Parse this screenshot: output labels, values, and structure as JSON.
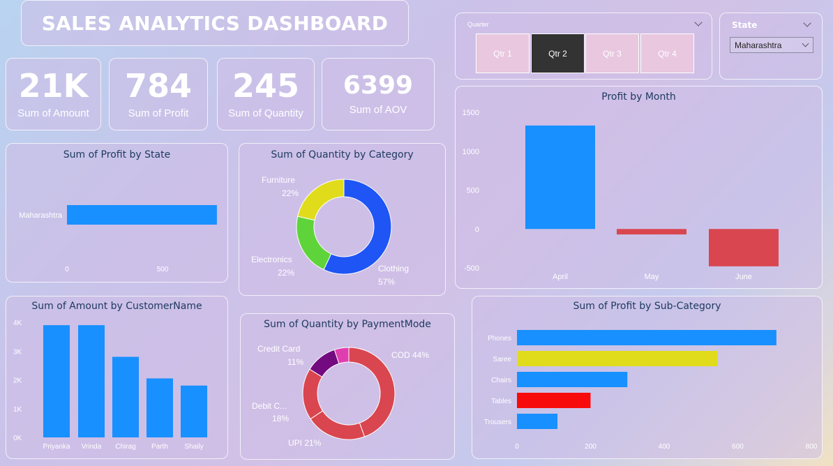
{
  "header": {
    "title": "SALES ANALYTICS DASHBOARD"
  },
  "kpis": [
    {
      "value": "21K",
      "label": "Sum of Amount"
    },
    {
      "value": "784",
      "label": "Sum of Profit"
    },
    {
      "value": "245",
      "label": "Sum of Quantity"
    },
    {
      "value": "6399",
      "label": "Sum of AOV"
    }
  ],
  "quarter_slicer": {
    "label": "Quarter",
    "options": [
      "Qtr 1",
      "Qtr 2",
      "Qtr 3",
      "Qtr 4"
    ],
    "selected": "Qtr 2"
  },
  "state_slicer": {
    "label": "State",
    "selected": "Maharashtra"
  },
  "colors": {
    "blue": "#1890ff",
    "red": "#d9464f",
    "yellow": "#e0dc1c",
    "green": "#5fd43a",
    "royal": "#1f55f5",
    "purple": "#740a80",
    "magenta": "#e03db0",
    "bright_red": "#f80b0b"
  },
  "chart_data": [
    {
      "id": "profit-by-state",
      "type": "bar",
      "orientation": "horizontal",
      "title": "Sum of Profit by State",
      "categories": [
        "Maharashtra"
      ],
      "values": [
        784
      ],
      "xticks": [
        "0",
        "500"
      ],
      "xlim": [
        0,
        850
      ]
    },
    {
      "id": "quantity-by-category",
      "type": "pie",
      "donut": true,
      "title": "Sum of Quantity by Category",
      "labels": [
        "Clothing",
        "Electronics",
        "Furniture"
      ],
      "percents": [
        "57%",
        "22%",
        "22%"
      ],
      "values": [
        57,
        21.5,
        21.5
      ]
    },
    {
      "id": "profit-by-month",
      "type": "bar",
      "title": "Profit by Month",
      "categories": [
        "April",
        "May",
        "June"
      ],
      "values": [
        1330,
        -70,
        -480
      ],
      "yticks": [
        "1500",
        "1000",
        "500",
        "0",
        "-500"
      ],
      "ylim": [
        -500,
        1500
      ]
    },
    {
      "id": "amount-by-customer",
      "type": "bar",
      "title": "Sum of Amount by CustomerName",
      "categories": [
        "Priyanka",
        "Vrinda",
        "Chirag",
        "Parth",
        "Shaily"
      ],
      "values": [
        3900,
        3900,
        2800,
        2050,
        1800
      ],
      "yticks": [
        "4K",
        "3K",
        "2K",
        "1K",
        "0K"
      ],
      "ylim": [
        0,
        4000
      ]
    },
    {
      "id": "quantity-by-paymentmode",
      "type": "pie",
      "donut": true,
      "title": "Sum of Quantity by PaymentMode",
      "labels": [
        "COD",
        "UPI",
        "Debit C...",
        "Credit Card",
        ""
      ],
      "percents": [
        "44%",
        "21%",
        "18%",
        "11%",
        ""
      ],
      "values": [
        44,
        21,
        18,
        11,
        5
      ]
    },
    {
      "id": "profit-by-subcategory",
      "type": "bar",
      "orientation": "horizontal",
      "title": "Sum of Profit by Sub-Category",
      "categories": [
        "Phones",
        "Saree",
        "Chairs",
        "Tables",
        "Trousers"
      ],
      "values": [
        705,
        545,
        300,
        200,
        110
      ],
      "xticks": [
        "0",
        "200",
        "400",
        "600",
        "800"
      ],
      "xlim": [
        0,
        800
      ]
    }
  ]
}
